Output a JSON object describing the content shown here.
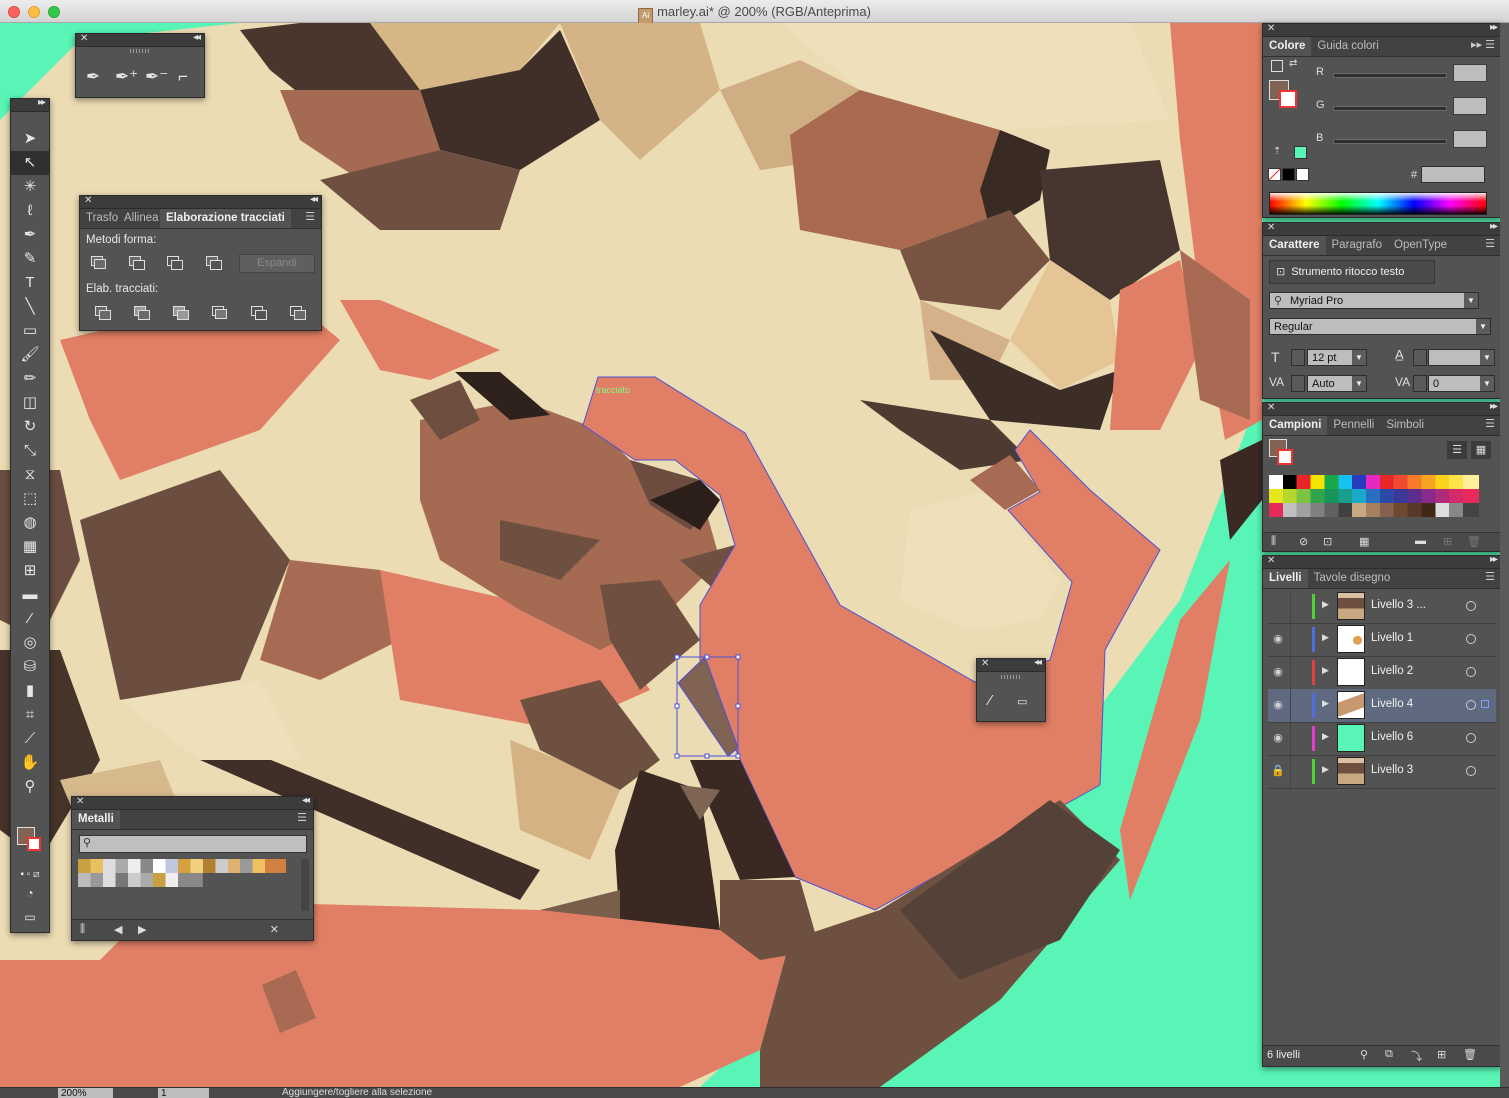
{
  "window": {
    "title": "marley.ai* @ 200% (RGB/Anteprima)",
    "app_icon": "ai-document-icon"
  },
  "canvas": {
    "path_label": "tracciato",
    "background_color": "#58f5b6"
  },
  "pathfinder_panel": {
    "tabs": [
      "Trasfo",
      "Allinea",
      "Elaborazione tracciati"
    ],
    "active_tab": "Elaborazione tracciati",
    "shape_modes_label": "Metodi forma:",
    "expand_label": "Espandi",
    "pathfinders_label": "Elab. tracciati:"
  },
  "metals_panel": {
    "tab": "Metalli",
    "search_placeholder": ""
  },
  "color_panel": {
    "tabs": [
      "Colore",
      "Guida colori"
    ],
    "channels": [
      {
        "label": "R",
        "value": ""
      },
      {
        "label": "G",
        "value": ""
      },
      {
        "label": "B",
        "value": ""
      }
    ],
    "hex_label": "#",
    "hex_value": ""
  },
  "character_panel": {
    "tabs": [
      "Carattere",
      "Paragrafo",
      "OpenType"
    ],
    "touch_type_label": "Strumento ritocco testo",
    "font_family": "Myriad Pro",
    "font_style": "Regular",
    "font_size": "12 pt",
    "leading": "",
    "kerning": "Auto",
    "tracking": "0"
  },
  "swatches_panel": {
    "tabs": [
      "Campioni",
      "Pennelli",
      "Simboli"
    ]
  },
  "layers_panel": {
    "tabs": [
      "Livelli",
      "Tavole disegno"
    ],
    "layers": [
      {
        "name": "Livello 3 ...",
        "visible": false,
        "locked": false,
        "color": "#4fd13a",
        "thumb": "photo",
        "selected": false
      },
      {
        "name": "Livello 1",
        "visible": true,
        "locked": false,
        "color": "#4f6fe0",
        "thumb": "sketch",
        "selected": false
      },
      {
        "name": "Livello 2",
        "visible": true,
        "locked": false,
        "color": "#e04040",
        "thumb": "white",
        "selected": false
      },
      {
        "name": "Livello 4",
        "visible": true,
        "locked": false,
        "color": "#4f6fe0",
        "thumb": "photo2",
        "selected": true
      },
      {
        "name": "Livello 6",
        "visible": true,
        "locked": false,
        "color": "#e040c8",
        "thumb": "mint",
        "selected": false
      },
      {
        "name": "Livello 3",
        "visible": false,
        "locked": true,
        "color": "#4fd13a",
        "thumb": "photo",
        "selected": false
      }
    ],
    "count_label": "6 livelli"
  },
  "status_bar": {
    "zoom": "200%",
    "page": "1",
    "message": "Aggiungere/togliere alla selezione"
  }
}
